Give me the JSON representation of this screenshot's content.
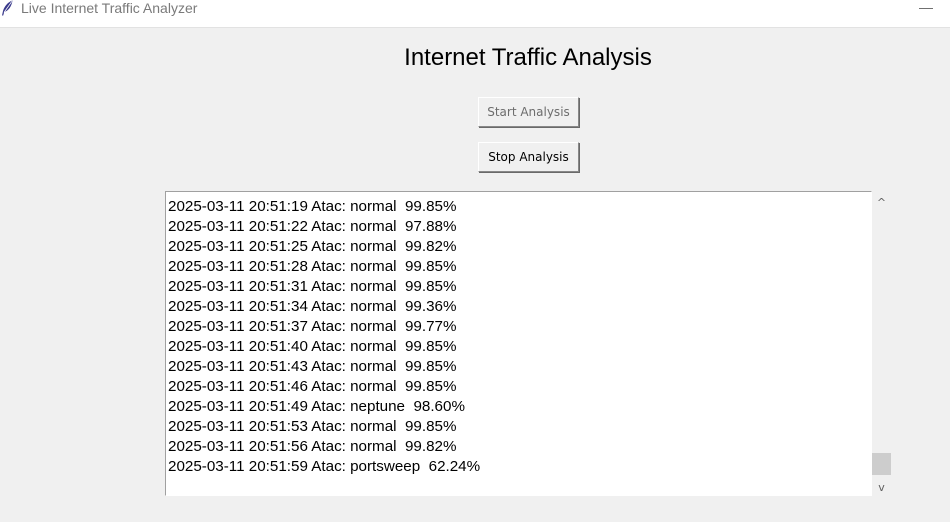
{
  "window": {
    "title": "Live Internet Traffic Analyzer",
    "minimize_glyph": "—",
    "app_icon": "feather-icon"
  },
  "main": {
    "heading": "Internet Traffic Analysis",
    "start_button": "Start Analysis",
    "stop_button": "Stop Analysis"
  },
  "log": {
    "lines": [
      "2025-03-11 20:51:19 Atac: normal  99.85%",
      "2025-03-11 20:51:22 Atac: normal  97.88%",
      "2025-03-11 20:51:25 Atac: normal  99.82%",
      "2025-03-11 20:51:28 Atac: normal  99.85%",
      "2025-03-11 20:51:31 Atac: normal  99.85%",
      "2025-03-11 20:51:34 Atac: normal  99.36%",
      "2025-03-11 20:51:37 Atac: normal  99.77%",
      "2025-03-11 20:51:40 Atac: normal  99.85%",
      "2025-03-11 20:51:43 Atac: normal  99.85%",
      "2025-03-11 20:51:46 Atac: normal  99.85%",
      "2025-03-11 20:51:49 Atac: neptune  98.60%",
      "2025-03-11 20:51:53 Atac: normal  99.85%",
      "2025-03-11 20:51:56 Atac: normal  99.82%",
      "2025-03-11 20:51:59 Atac: portsweep  62.24%"
    ]
  },
  "scrollbar": {
    "up_glyph": "^",
    "down_glyph": "v"
  },
  "colors": {
    "window_bg": "#f0f0f0",
    "log_bg": "#ffffff",
    "disabled_text": "#6d6d6d"
  }
}
